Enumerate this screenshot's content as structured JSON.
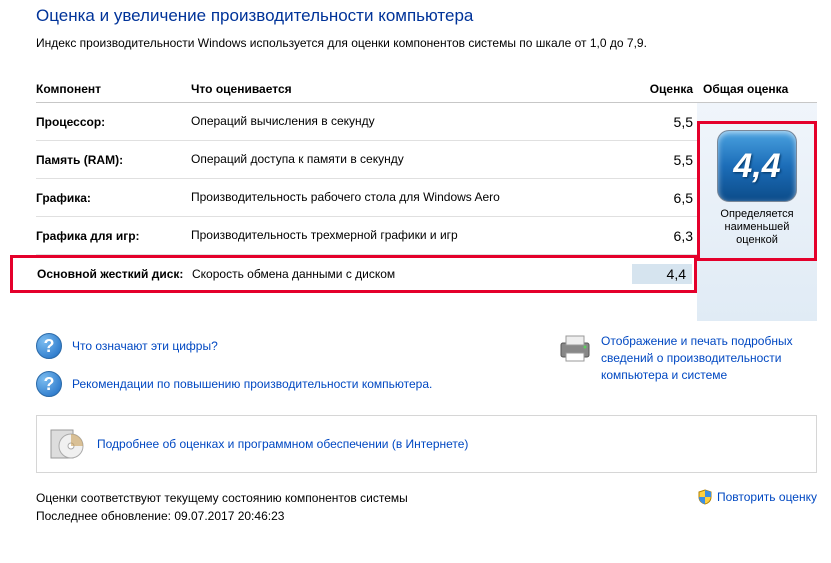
{
  "title": "Оценка и увеличение производительности компьютера",
  "subtitle": "Индекс производительности Windows используется для оценки компонентов системы по шкале от 1,0 до 7,9.",
  "headers": {
    "component": "Компонент",
    "description": "Что оценивается",
    "score": "Оценка",
    "overall": "Общая оценка"
  },
  "rows": [
    {
      "component": "Процессор:",
      "description": "Операций вычисления в секунду",
      "score": "5,5"
    },
    {
      "component": "Память (RAM):",
      "description": "Операций доступа к памяти в секунду",
      "score": "5,5"
    },
    {
      "component": "Графика:",
      "description": "Производительность рабочего стола для Windows Aero",
      "score": "6,5"
    },
    {
      "component": "Графика для игр:",
      "description": "Производительность трехмерной графики и игр",
      "score": "6,3"
    },
    {
      "component": "Основной жесткий диск:",
      "description": "Скорость обмена данными с диском",
      "score": "4,4"
    }
  ],
  "overall": {
    "score": "4,4",
    "caption": "Определяется наименьшей оценкой"
  },
  "links": {
    "what": "Что означают эти цифры?",
    "recommend": "Рекомендации по повышению производительности компьютера.",
    "print": "Отображение и печать подробных сведений о производительности компьютера и системе",
    "software": "Подробнее об оценках и программном обеспечении (в Интернете)"
  },
  "status": {
    "match": "Оценки соответствуют текущему состоянию компонентов системы",
    "last_update": "Последнее обновление: 09.07.2017 20:46:23",
    "rerun": "Повторить оценку"
  }
}
